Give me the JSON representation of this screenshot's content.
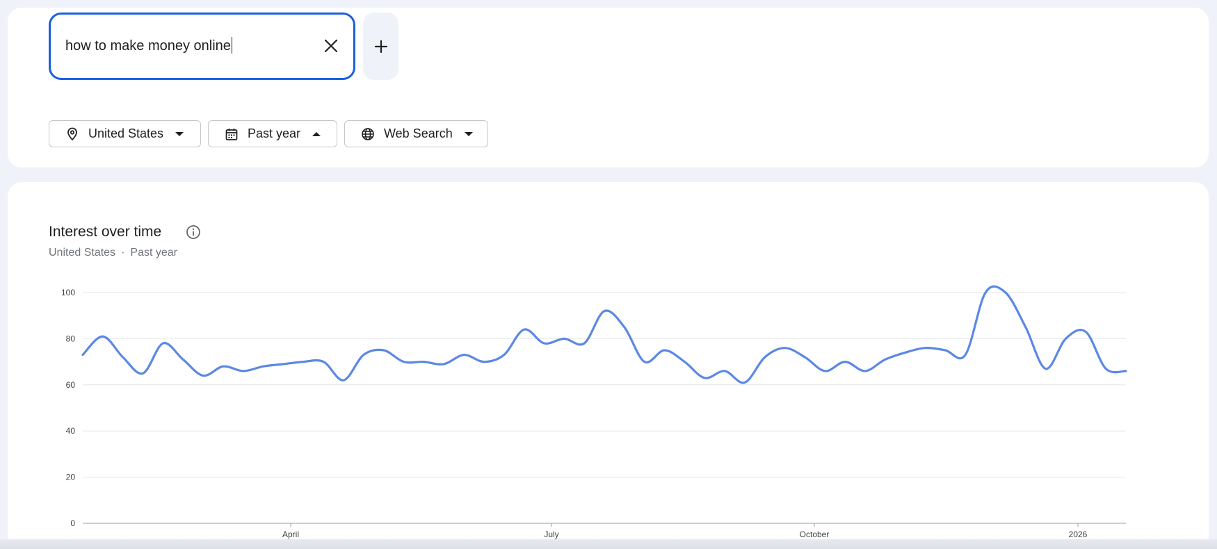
{
  "search": {
    "query": "how to make money online",
    "clear_icon": "close-icon",
    "add_icon": "plus-icon"
  },
  "filters": {
    "location": {
      "label": "United States",
      "icon": "location-pin-icon"
    },
    "time": {
      "label": "Past year",
      "icon": "calendar-icon"
    },
    "type": {
      "label": "Web Search",
      "icon": "globe-icon"
    }
  },
  "chart_section": {
    "title": "Interest over time",
    "subtitle_location": "United States",
    "subtitle_separator": "·",
    "subtitle_time": "Past year"
  },
  "colors": {
    "accent": "#1a5fe0",
    "line": "#5b88e4",
    "grid": "#e4e6e8",
    "page_bg": "#eff2f8"
  },
  "chart_data": {
    "type": "line",
    "x_tick_labels": [
      "April",
      "July",
      "October",
      "2026"
    ],
    "ylim": [
      0,
      100
    ],
    "y_ticks": [
      0,
      20,
      40,
      60,
      80,
      100
    ],
    "grid": true,
    "series": [
      {
        "values": [
          73,
          81,
          72,
          65,
          78,
          71,
          64,
          68,
          66,
          68,
          69,
          70,
          70,
          62,
          73,
          75,
          70,
          70,
          69,
          73,
          70,
          73,
          84,
          78,
          80,
          78,
          92,
          85,
          70,
          75,
          70,
          63,
          66,
          61,
          72,
          76,
          72,
          66,
          70,
          66,
          71,
          74,
          76,
          75,
          73,
          100,
          100,
          85,
          67,
          80,
          83,
          67,
          66
        ]
      }
    ]
  }
}
